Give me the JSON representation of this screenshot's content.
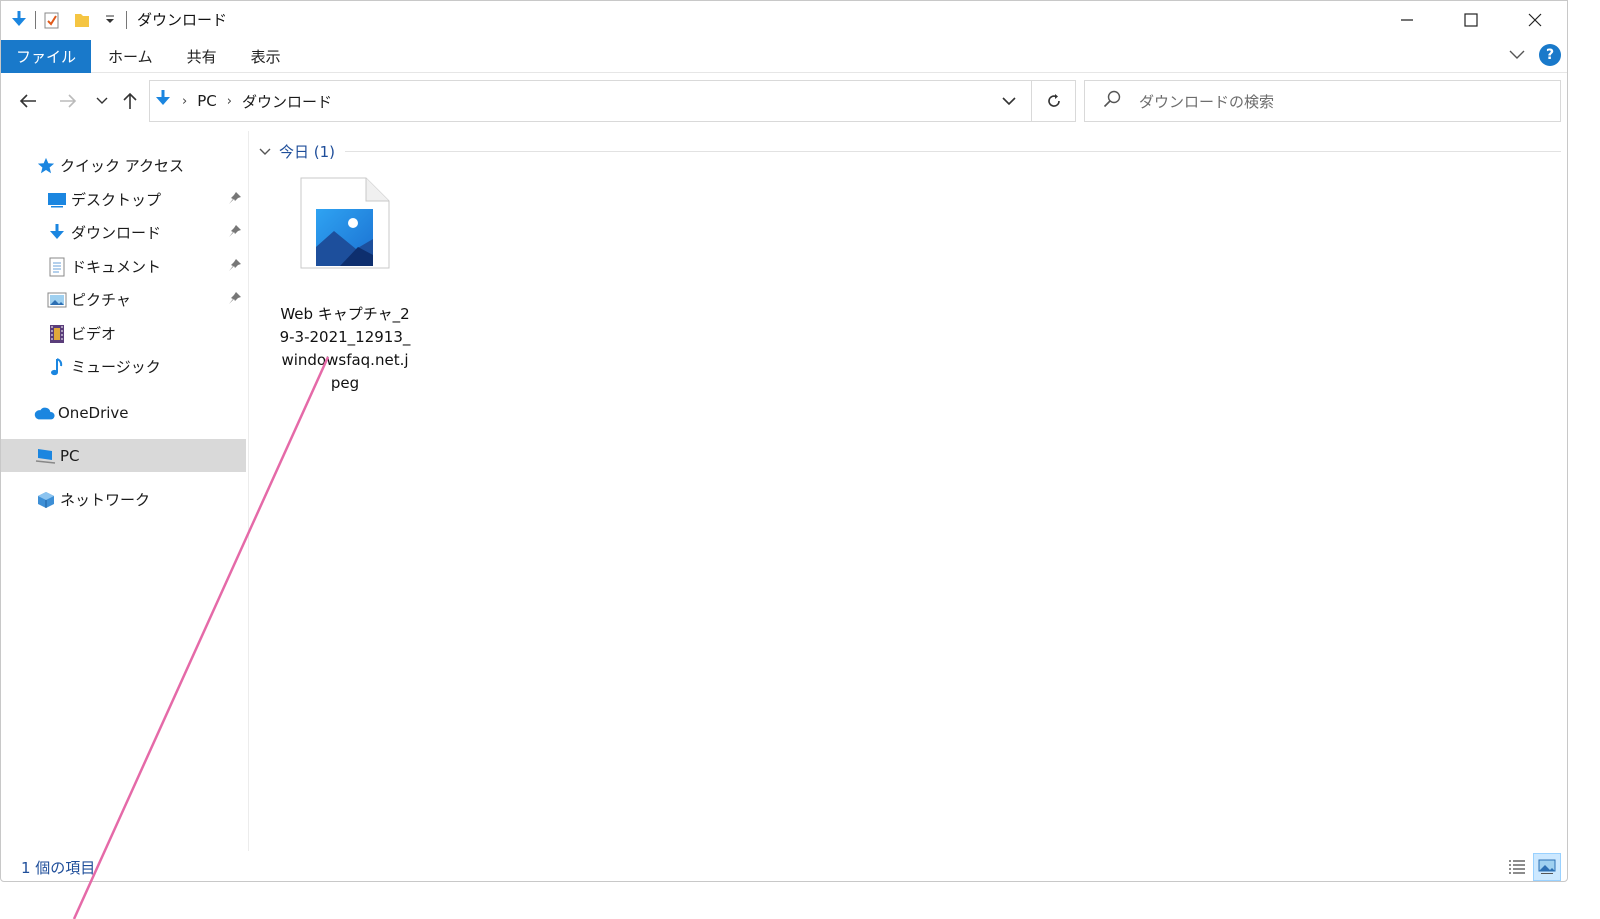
{
  "window": {
    "title": "ダウンロード",
    "controls": [
      "minimize",
      "maximize",
      "close"
    ]
  },
  "ribbon": {
    "tabs": [
      "ファイル",
      "ホーム",
      "共有",
      "表示"
    ],
    "help_label": "?"
  },
  "address": {
    "segments": [
      "PC",
      "ダウンロード"
    ],
    "search_placeholder": "ダウンロードの検索"
  },
  "nav": {
    "quick_access": "クイック アクセス",
    "items": [
      {
        "label": "デスクトップ",
        "icon": "desktop-icon",
        "pinned": true
      },
      {
        "label": "ダウンロード",
        "icon": "download-icon",
        "pinned": true
      },
      {
        "label": "ドキュメント",
        "icon": "document-icon",
        "pinned": true
      },
      {
        "label": "ピクチャ",
        "icon": "picture-icon",
        "pinned": true
      },
      {
        "label": "ビデオ",
        "icon": "video-icon",
        "pinned": false
      },
      {
        "label": "ミュージック",
        "icon": "music-icon",
        "pinned": false
      }
    ],
    "onedrive": "OneDrive",
    "pc": "PC",
    "network": "ネットワーク"
  },
  "content": {
    "group_label": "今日 (1)",
    "files": [
      {
        "name": "Web キャプチャ_29-3-2021_12913_windowsfaq.net.jpeg",
        "icon": "image-file-icon"
      }
    ]
  },
  "status": {
    "count_text": "1 個の項目"
  },
  "colors": {
    "accent": "#1979ca",
    "selection": "#d9d9d9",
    "group_text": "#1f4e9a",
    "annotation_line": "#e56aa8"
  }
}
